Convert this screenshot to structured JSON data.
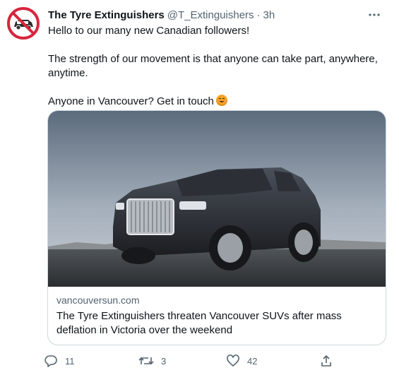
{
  "tweet": {
    "author_name": "The Tyre Extinguishers",
    "handle": "@T_Extinguishers",
    "separator": "·",
    "time": "3h",
    "lines": [
      "Hello to our many new Canadian followers!",
      "The strength of our movement is that anyone can take part, anywhere,",
      "anytime.",
      "Anyone in Vancouver? Get in touch"
    ],
    "emoji_icon": "smiling-face-emoji"
  },
  "card": {
    "domain": "vancouversun.com",
    "title": "The Tyre Extinguishers threaten Vancouver SUVs after mass deflation in Victoria over the weekend"
  },
  "actions": {
    "reply_count": "11",
    "retweet_count": "3",
    "like_count": "42"
  },
  "colors": {
    "text": "#0f1419",
    "secondary": "#536471",
    "border": "#cfd9de",
    "avatar_ring": "#e0245e"
  }
}
